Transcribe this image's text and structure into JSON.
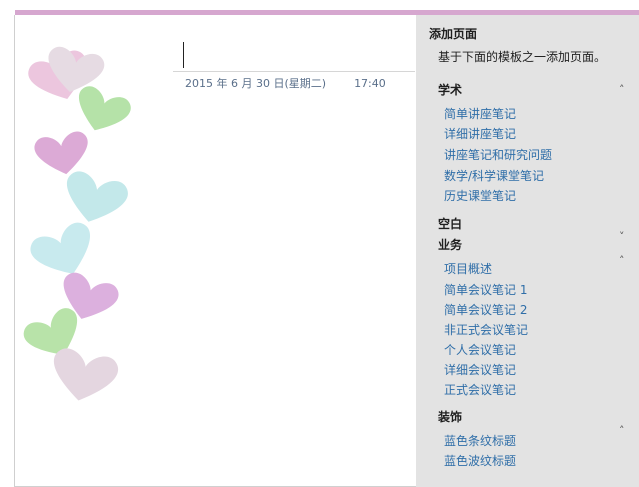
{
  "page": {
    "date": "2015 年 6 月 30 日(星期二)",
    "time": "17:40"
  },
  "pane": {
    "title": "添加页面",
    "description": "基于下面的模板之一添加页面。",
    "sections": {
      "academic": {
        "label": "学术",
        "items": [
          "简单讲座笔记",
          "详细讲座笔记",
          "讲座笔记和研究问题",
          "数学/科学课堂笔记",
          "历史课堂笔记"
        ]
      },
      "blank": {
        "label": "空白"
      },
      "business": {
        "label": "业务",
        "items": [
          "项目概述",
          "简单会议笔记 1",
          "简单会议笔记 2",
          "非正式会议笔记",
          "个人会议笔记",
          "详细会议笔记",
          "正式会议笔记"
        ]
      },
      "decorative": {
        "label": "装饰",
        "items": [
          "蓝色条纹标题",
          "蓝色波纹标题"
        ]
      }
    }
  },
  "colors": {
    "accent_bar": "#d6a7cf",
    "link": "#2f6ea8",
    "pane_background": "#e3e3e3"
  },
  "icons": {
    "collapse": "chevron-up-icon",
    "expand": "chevron-down-icon"
  }
}
